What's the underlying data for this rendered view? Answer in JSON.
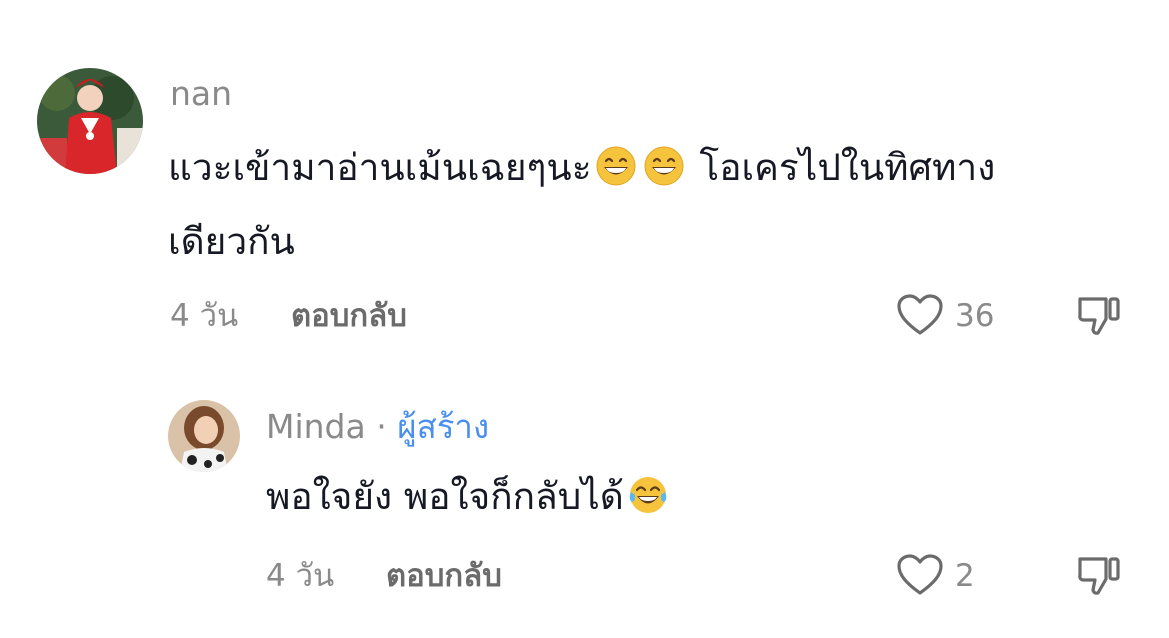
{
  "comments": [
    {
      "username": "nan",
      "text_line1_part1": "แวะเข้ามาอ่านเม้นเฉยๆนะ",
      "emoji_1": "grinning-face-with-smiling-eyes",
      "emoji_2": "grinning-face-with-smiling-eyes",
      "text_line1_part2": "โอเครไปในทิศทาง",
      "text_line2": "เดียวกัน",
      "time": "4 วัน",
      "reply_label": "ตอบกลับ",
      "like_count": "36"
    },
    {
      "username": "Minda",
      "separator": "·",
      "creator_label": "ผู้สร้าง",
      "text": "พอใจยัง พอใจก็กลับได้",
      "emoji": "face-with-tears-of-joy",
      "time": "4 วัน",
      "reply_label": "ตอบกลับ",
      "like_count": "2"
    }
  ],
  "colors": {
    "text_primary": "#161823",
    "text_secondary": "#8a8a8a",
    "creator_badge": "#4a8ff0"
  }
}
